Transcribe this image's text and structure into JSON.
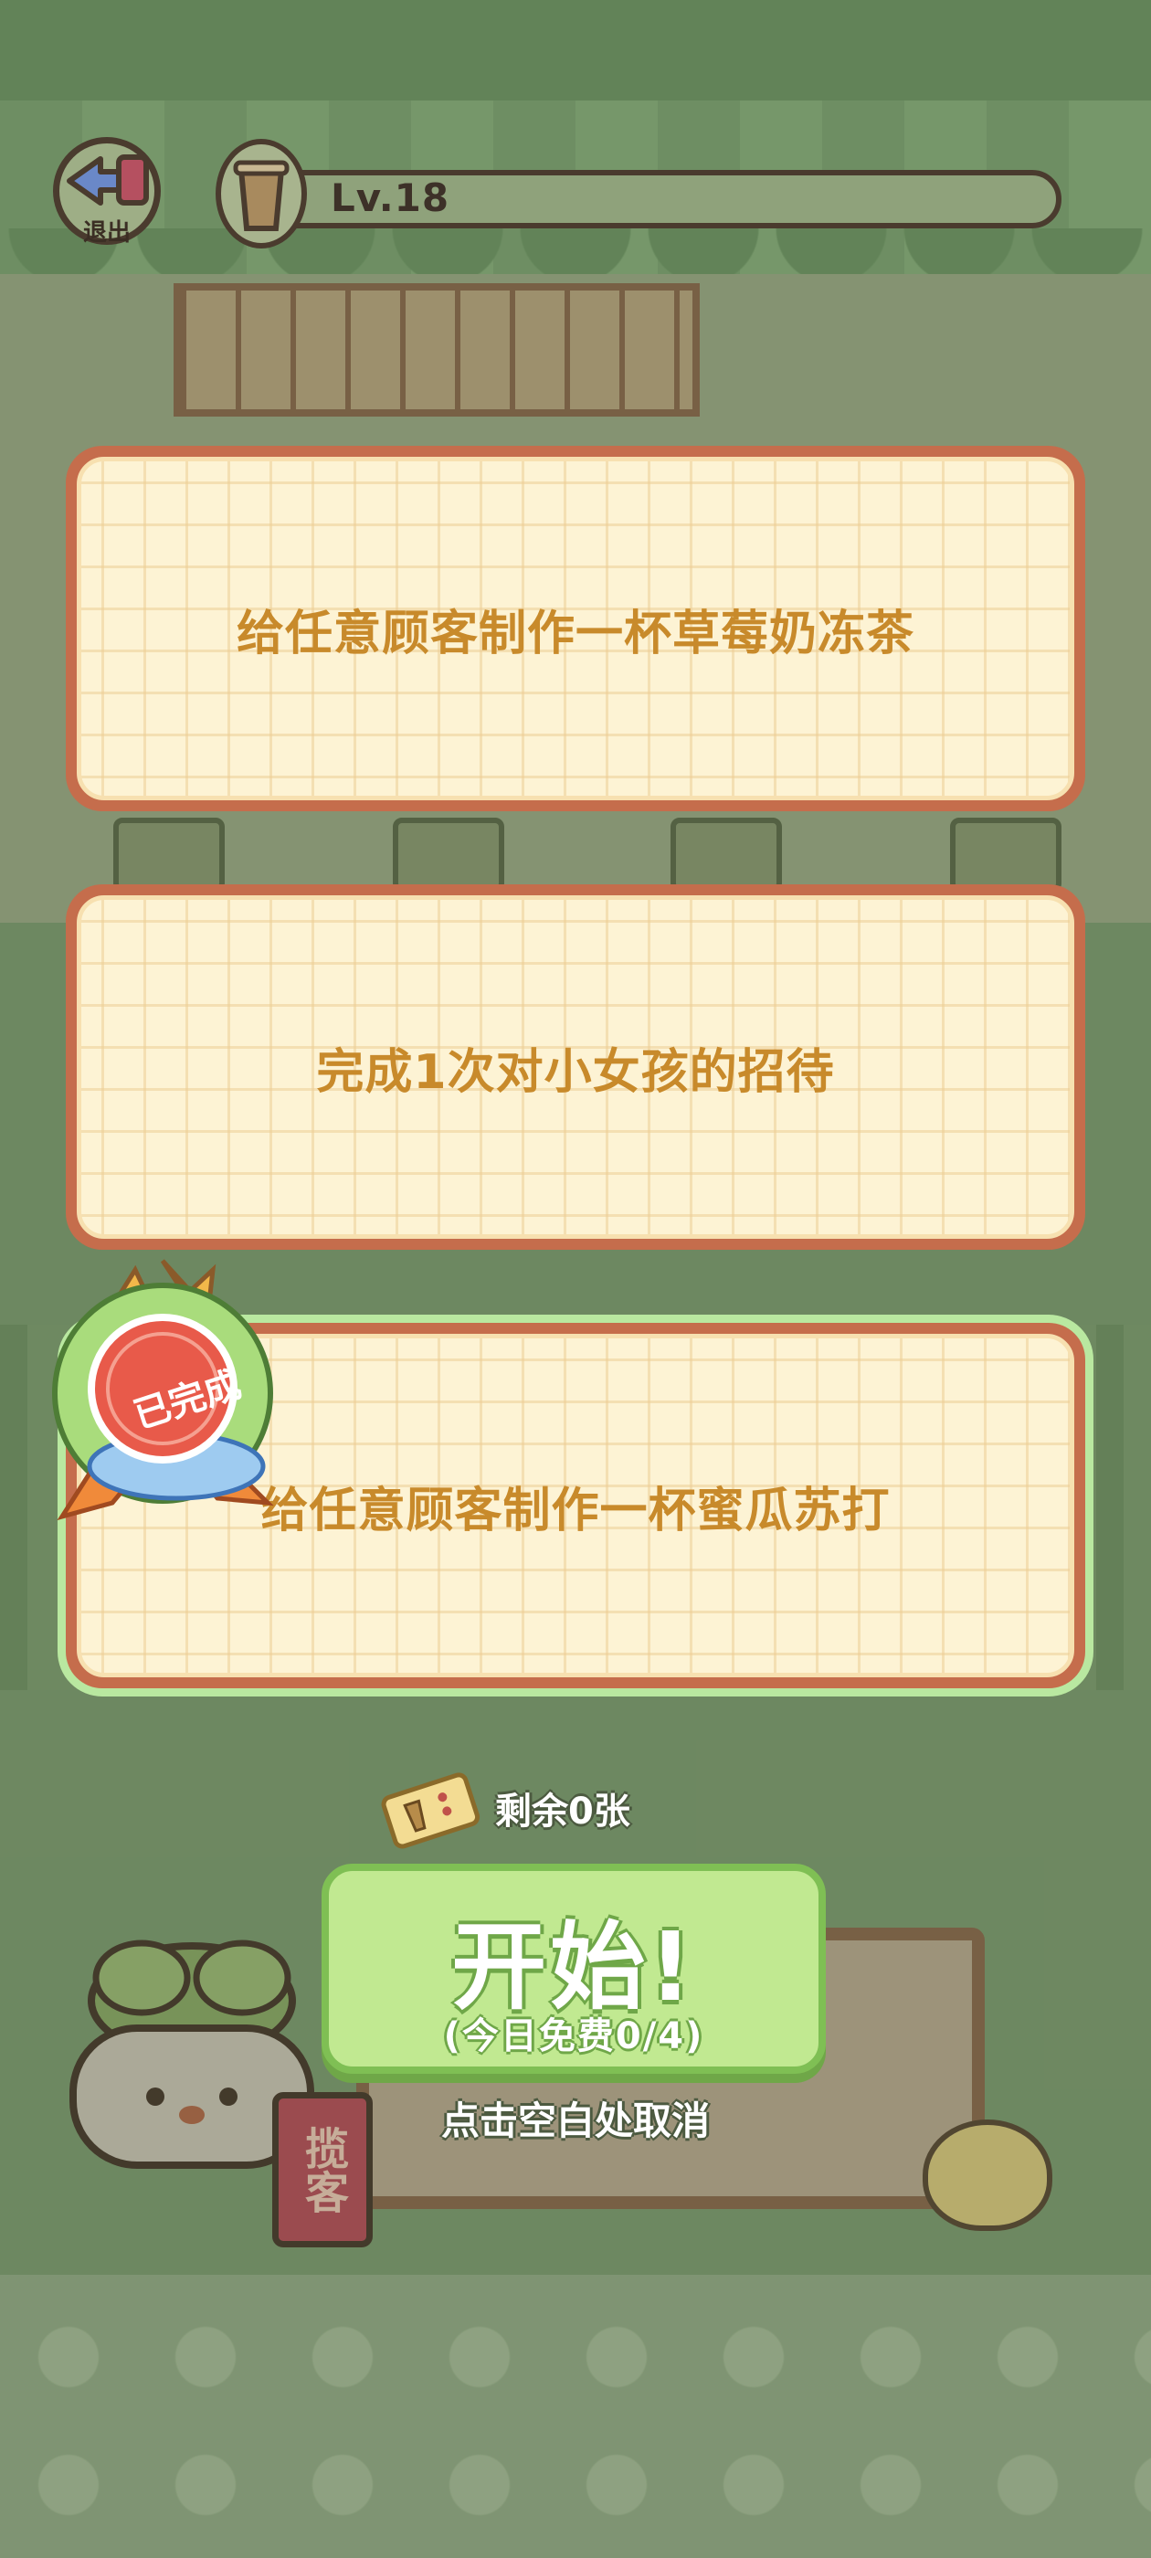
{
  "top_bar": {
    "exit_label": "退出",
    "level_text": "Lv.18"
  },
  "tasks": [
    {
      "text": "给任意顾客制作一杯草莓奶冻茶",
      "completed": false
    },
    {
      "text": "完成1次对小女孩的招待",
      "completed": false
    },
    {
      "text": "给任意顾客制作一杯蜜瓜苏打",
      "completed": true
    }
  ],
  "completed_badge": "已完成",
  "tickets": {
    "remaining_text": "剩余0张"
  },
  "start_button": {
    "label": "开始!",
    "subtitle": "(今日免费0/4)"
  },
  "cancel_hint": "点击空白处取消",
  "scene": {
    "sign_label": "揽客"
  },
  "colors": {
    "card_border": "#c56d4c",
    "card_fill": "#fdf3d4",
    "task_text": "#c88a2b",
    "completed_glow": "#b9e8a0",
    "start_fill": "#c1e991",
    "start_border": "#7fbf54"
  }
}
